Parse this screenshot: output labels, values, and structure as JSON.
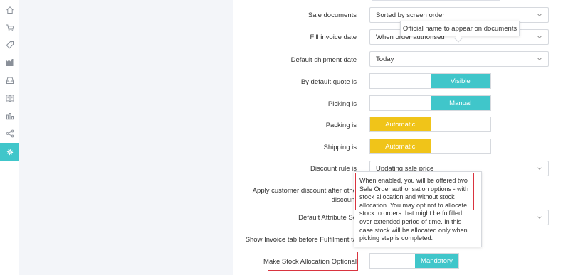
{
  "sidebar": {
    "items": [
      {
        "icon": "home-icon"
      },
      {
        "icon": "cart-icon"
      },
      {
        "icon": "tag-icon"
      },
      {
        "icon": "factory-icon"
      },
      {
        "icon": "inbox-icon"
      },
      {
        "icon": "book-icon"
      },
      {
        "icon": "bar-chart-icon"
      },
      {
        "icon": "share-icon"
      },
      {
        "icon": "settings-icon",
        "active": true
      }
    ],
    "active_color": "#40c6ca"
  },
  "settings": {
    "sale_documents": {
      "label": "Sale documents",
      "value": "Sorted by screen order"
    },
    "fill_invoice_date": {
      "label": "Fill invoice date",
      "value": "When order authorised"
    },
    "default_shipment_date": {
      "label": "Default shipment date",
      "value": "Today"
    },
    "default_quote": {
      "label": "By default quote is",
      "selected": "Visible"
    },
    "picking": {
      "label": "Picking is",
      "selected": "Manual"
    },
    "packing": {
      "label": "Packing is",
      "selected": "Automatic"
    },
    "shipping": {
      "label": "Shipping is",
      "selected": "Automatic"
    },
    "discount_rule": {
      "label": "Discount rule is",
      "value": "Updating sale price"
    },
    "apply_customer_discount": {
      "label_line1": "Apply customer discount after othe",
      "label_line2": "discount"
    },
    "default_attribute_set": {
      "label": "Default Attribute Se"
    },
    "show_invoice_tab": {
      "label": "Show Invoice tab before Fulfilment ta"
    },
    "stock_allocation": {
      "label": "Make Stock Allocation Optional",
      "selected": "Mandatory"
    }
  },
  "tooltips": {
    "official_name": "Official name to appear on documents",
    "stock_allocation_help": "When enabled, you will be offered two Sale Order authorisation options - with stock allocation and without stock allocation. You may opt not to allocate stock to orders that might be fulfilled over extended period of time. In this case stock will be allocated only when picking step is completed."
  },
  "colors": {
    "teal": "#40c6ca",
    "yellow": "#f0c419",
    "highlight_red": "#d9343f",
    "gutter": "#f3f5f9"
  }
}
